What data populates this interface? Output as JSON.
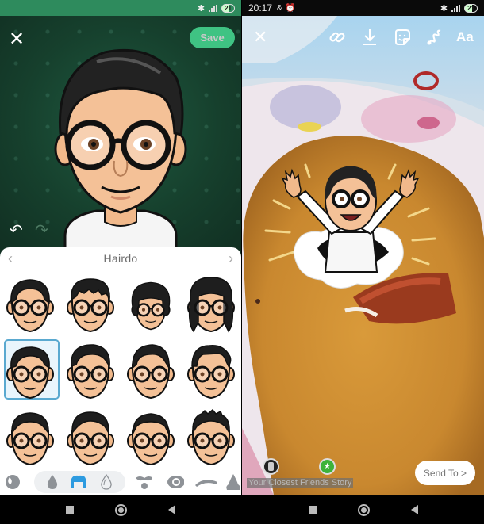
{
  "left_screen": {
    "status_bar": {
      "battery": "21",
      "icons": [
        "bluetooth-icon",
        "signal-icon",
        "battery-icon"
      ]
    },
    "header": {
      "close_icon": "close-icon",
      "save_label": "Save"
    },
    "history": {
      "undo_icon": "undo-icon",
      "redo_icon": "redo-icon"
    },
    "sheet": {
      "title": "Hairdo",
      "prev_icon": "chevron-left-icon",
      "next_icon": "chevron-right-icon",
      "options": [
        {
          "style": "bowl",
          "selected": false
        },
        {
          "style": "shaggy-fringe",
          "selected": false
        },
        {
          "style": "afro",
          "selected": false
        },
        {
          "style": "long-curly",
          "selected": false
        },
        {
          "style": "side-swept",
          "selected": true
        },
        {
          "style": "quiff",
          "selected": false
        },
        {
          "style": "undercut",
          "selected": false
        },
        {
          "style": "side-part-wave",
          "selected": false
        },
        {
          "style": "short-crop",
          "selected": false
        },
        {
          "style": "short-textured",
          "selected": false
        },
        {
          "style": "crew",
          "selected": false
        },
        {
          "style": "spiky",
          "selected": false
        }
      ],
      "categories": [
        {
          "icon": "skin-tone-icon",
          "active": false
        },
        {
          "icon": "hair-color-icon",
          "active": false
        },
        {
          "icon": "hairstyle-icon",
          "active": true
        },
        {
          "icon": "hair-highlight-icon",
          "active": false
        },
        {
          "icon": "facial-hair-icon",
          "active": false
        },
        {
          "icon": "eye-icon",
          "active": false
        },
        {
          "icon": "eyebrow-icon",
          "active": false
        },
        {
          "icon": "nose-icon",
          "active": false
        }
      ],
      "active_color": "#2d9be0"
    },
    "accent_color": "#3fc383"
  },
  "right_screen": {
    "status_bar": {
      "time": "20:17",
      "battery": "21",
      "icons": [
        "notification-icon",
        "alarm-icon",
        "bluetooth-icon",
        "signal-icon",
        "battery-icon"
      ]
    },
    "toolbar": {
      "close_icon": "close-icon",
      "tools": [
        "link-icon",
        "download-icon",
        "sticker-icon",
        "draw-icon"
      ],
      "text_tool_label": "Aa"
    },
    "sticker": "bitmoji-bursting-out",
    "story": {
      "closest_friends_label": "Your Closest Friends Story"
    },
    "send_to_label": "Send To >",
    "accent_color": "#3db33a"
  },
  "nav_bar": {
    "buttons": [
      "recents-button",
      "home-button",
      "back-button"
    ]
  }
}
